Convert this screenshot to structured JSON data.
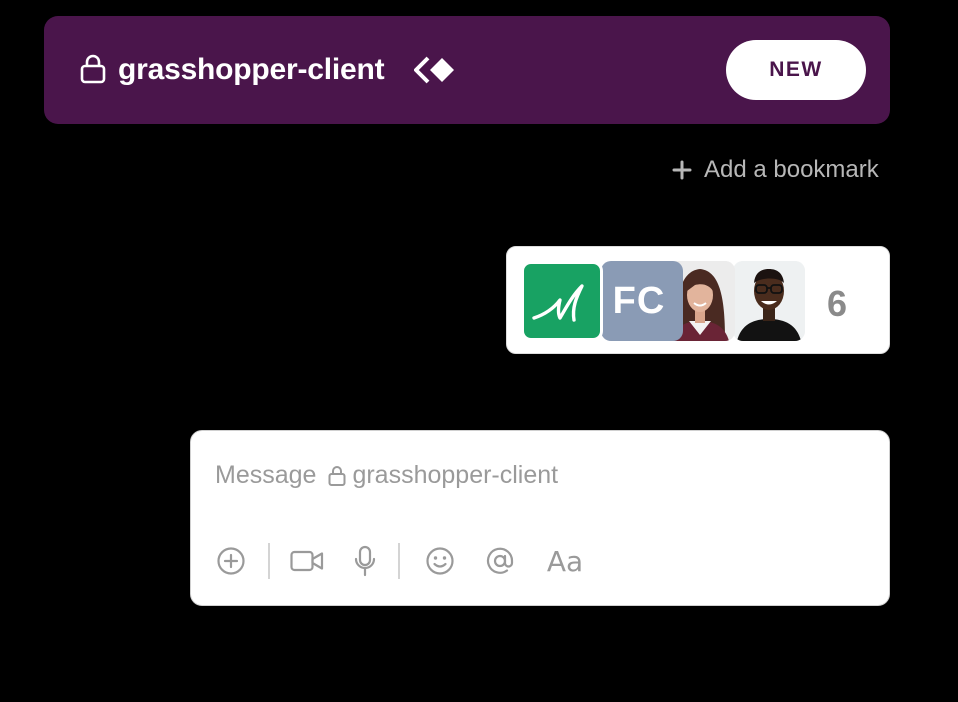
{
  "channel": {
    "name": "grasshopper-client",
    "new_button_label": "NEW"
  },
  "bookmark": {
    "label": "Add a bookmark"
  },
  "members": {
    "avatars": [
      {
        "type": "logo",
        "name": "grasshopper-logo"
      },
      {
        "type": "initials",
        "text": "FC"
      },
      {
        "type": "photo",
        "name": "woman-photo"
      },
      {
        "type": "photo",
        "name": "man-photo"
      }
    ],
    "count": "6"
  },
  "composer": {
    "placeholder_prefix": "Message",
    "placeholder_channel": "grasshopper-client",
    "tools": [
      "plus-circle-icon",
      "video-icon",
      "microphone-icon",
      "emoji-icon",
      "mention-icon",
      "formatting-icon"
    ],
    "format_label": "Aa"
  },
  "colors": {
    "header_bg": "#4a154b",
    "logo_green": "#18a263",
    "initials_bg": "#8a9bb5"
  }
}
